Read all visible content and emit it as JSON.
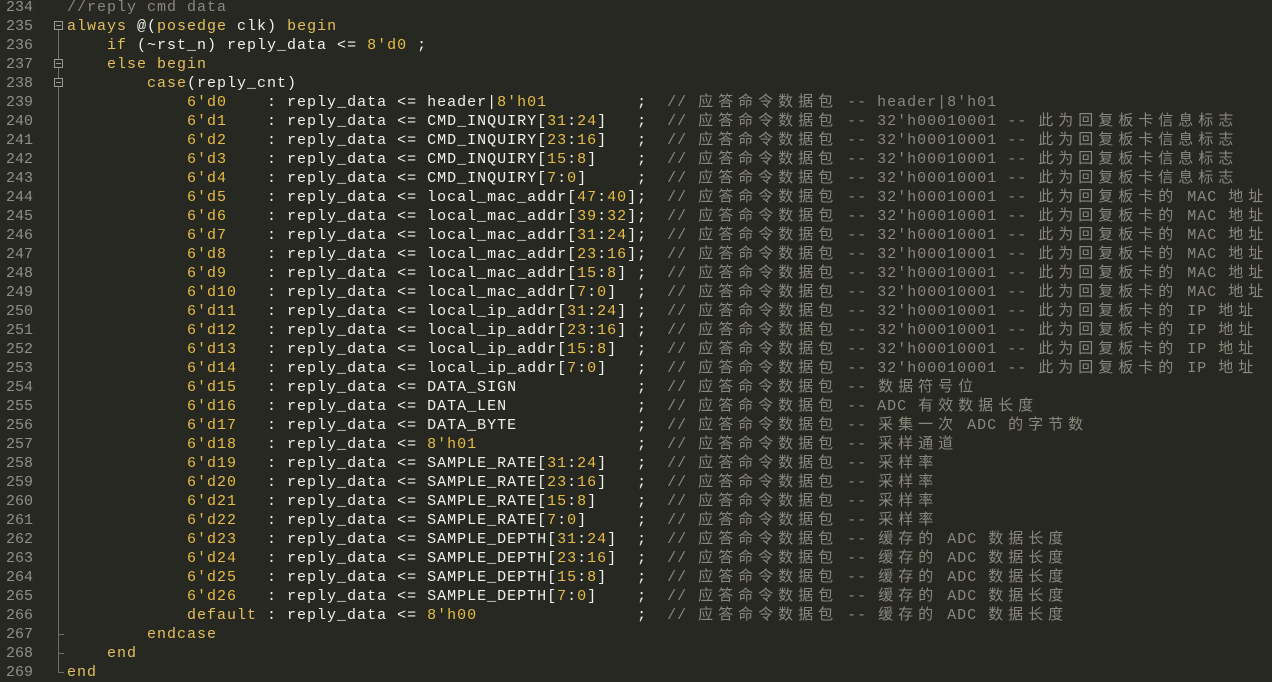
{
  "colors": {
    "background": "#272822",
    "text": "#f1f1ec",
    "keyword": "#e3c05c",
    "number": "#e6bd45",
    "comment": "#8a887d",
    "line_number": "#8f908a"
  },
  "lines": [
    {
      "number": "234",
      "fold": "none",
      "code": "",
      "comment": "//reply cmd data"
    },
    {
      "number": "235",
      "fold": "start",
      "code": "always @(posedge clk) begin",
      "comment": ""
    },
    {
      "number": "236",
      "fold": "body",
      "code": "    if (~rst_n) reply_data <= 8'd0 ;",
      "comment": ""
    },
    {
      "number": "237",
      "fold": "start-nested",
      "code": "    else begin",
      "comment": ""
    },
    {
      "number": "238",
      "fold": "start-nested",
      "code": "        case(reply_cnt)",
      "comment": ""
    },
    {
      "number": "239",
      "fold": "body",
      "code": "            6'd0    : reply_data <= header|8'h01         ;  ",
      "comment": "// 应答命令数据包 -- header|8'h01"
    },
    {
      "number": "240",
      "fold": "body",
      "code": "            6'd1    : reply_data <= CMD_INQUIRY[31:24]   ;  ",
      "comment": "// 应答命令数据包 -- 32'h00010001 -- 此为回复板卡信息标志"
    },
    {
      "number": "241",
      "fold": "body",
      "code": "            6'd2    : reply_data <= CMD_INQUIRY[23:16]   ;  ",
      "comment": "// 应答命令数据包 -- 32'h00010001 -- 此为回复板卡信息标志"
    },
    {
      "number": "242",
      "fold": "body",
      "code": "            6'd3    : reply_data <= CMD_INQUIRY[15:8]    ;  ",
      "comment": "// 应答命令数据包 -- 32'h00010001 -- 此为回复板卡信息标志"
    },
    {
      "number": "243",
      "fold": "body",
      "code": "            6'd4    : reply_data <= CMD_INQUIRY[7:0]     ;  ",
      "comment": "// 应答命令数据包 -- 32'h00010001 -- 此为回复板卡信息标志"
    },
    {
      "number": "244",
      "fold": "body",
      "code": "            6'd5    : reply_data <= local_mac_addr[47:40];  ",
      "comment": "// 应答命令数据包 -- 32'h00010001 -- 此为回复板卡的 MAC 地址"
    },
    {
      "number": "245",
      "fold": "body",
      "code": "            6'd6    : reply_data <= local_mac_addr[39:32];  ",
      "comment": "// 应答命令数据包 -- 32'h00010001 -- 此为回复板卡的 MAC 地址"
    },
    {
      "number": "246",
      "fold": "body",
      "code": "            6'd7    : reply_data <= local_mac_addr[31:24];  ",
      "comment": "// 应答命令数据包 -- 32'h00010001 -- 此为回复板卡的 MAC 地址"
    },
    {
      "number": "247",
      "fold": "body",
      "code": "            6'd8    : reply_data <= local_mac_addr[23:16];  ",
      "comment": "// 应答命令数据包 -- 32'h00010001 -- 此为回复板卡的 MAC 地址"
    },
    {
      "number": "248",
      "fold": "body",
      "code": "            6'd9    : reply_data <= local_mac_addr[15:8] ;  ",
      "comment": "// 应答命令数据包 -- 32'h00010001 -- 此为回复板卡的 MAC 地址"
    },
    {
      "number": "249",
      "fold": "body",
      "code": "            6'd10   : reply_data <= local_mac_addr[7:0]  ;  ",
      "comment": "// 应答命令数据包 -- 32'h00010001 -- 此为回复板卡的 MAC 地址"
    },
    {
      "number": "250",
      "fold": "body",
      "code": "            6'd11   : reply_data <= local_ip_addr[31:24] ;  ",
      "comment": "// 应答命令数据包 -- 32'h00010001 -- 此为回复板卡的 IP 地址"
    },
    {
      "number": "251",
      "fold": "body",
      "code": "            6'd12   : reply_data <= local_ip_addr[23:16] ;  ",
      "comment": "// 应答命令数据包 -- 32'h00010001 -- 此为回复板卡的 IP 地址"
    },
    {
      "number": "252",
      "fold": "body",
      "code": "            6'd13   : reply_data <= local_ip_addr[15:8]  ;  ",
      "comment": "// 应答命令数据包 -- 32'h00010001 -- 此为回复板卡的 IP 地址"
    },
    {
      "number": "253",
      "fold": "body",
      "code": "            6'd14   : reply_data <= local_ip_addr[7:0]   ;  ",
      "comment": "// 应答命令数据包 -- 32'h00010001 -- 此为回复板卡的 IP 地址"
    },
    {
      "number": "254",
      "fold": "body",
      "code": "            6'd15   : reply_data <= DATA_SIGN            ;  ",
      "comment": "// 应答命令数据包 -- 数据符号位"
    },
    {
      "number": "255",
      "fold": "body",
      "code": "            6'd16   : reply_data <= DATA_LEN             ;  ",
      "comment": "// 应答命令数据包 -- ADC 有效数据长度"
    },
    {
      "number": "256",
      "fold": "body",
      "code": "            6'd17   : reply_data <= DATA_BYTE            ;  ",
      "comment": "// 应答命令数据包 -- 采集一次 ADC 的字节数"
    },
    {
      "number": "257",
      "fold": "body",
      "code": "            6'd18   : reply_data <= 8'h01                ;  ",
      "comment": "// 应答命令数据包 -- 采样通道"
    },
    {
      "number": "258",
      "fold": "body",
      "code": "            6'd19   : reply_data <= SAMPLE_RATE[31:24]   ;  ",
      "comment": "// 应答命令数据包 -- 采样率"
    },
    {
      "number": "259",
      "fold": "body",
      "code": "            6'd20   : reply_data <= SAMPLE_RATE[23:16]   ;  ",
      "comment": "// 应答命令数据包 -- 采样率"
    },
    {
      "number": "260",
      "fold": "body",
      "code": "            6'd21   : reply_data <= SAMPLE_RATE[15:8]    ;  ",
      "comment": "// 应答命令数据包 -- 采样率"
    },
    {
      "number": "261",
      "fold": "body",
      "code": "            6'd22   : reply_data <= SAMPLE_RATE[7:0]     ;  ",
      "comment": "// 应答命令数据包 -- 采样率"
    },
    {
      "number": "262",
      "fold": "body",
      "code": "            6'd23   : reply_data <= SAMPLE_DEPTH[31:24]  ;  ",
      "comment": "// 应答命令数据包 -- 缓存的 ADC 数据长度"
    },
    {
      "number": "263",
      "fold": "body",
      "code": "            6'd24   : reply_data <= SAMPLE_DEPTH[23:16]  ;  ",
      "comment": "// 应答命令数据包 -- 缓存的 ADC 数据长度"
    },
    {
      "number": "264",
      "fold": "body",
      "code": "            6'd25   : reply_data <= SAMPLE_DEPTH[15:8]   ;  ",
      "comment": "// 应答命令数据包 -- 缓存的 ADC 数据长度"
    },
    {
      "number": "265",
      "fold": "body",
      "code": "            6'd26   : reply_data <= SAMPLE_DEPTH[7:0]    ;  ",
      "comment": "// 应答命令数据包 -- 缓存的 ADC 数据长度"
    },
    {
      "number": "266",
      "fold": "body",
      "code": "            default : reply_data <= 8'h00                ;  ",
      "comment": "// 应答命令数据包 -- 缓存的 ADC 数据长度"
    },
    {
      "number": "267",
      "fold": "end",
      "code": "        endcase",
      "comment": ""
    },
    {
      "number": "268",
      "fold": "end",
      "code": "    end",
      "comment": ""
    },
    {
      "number": "269",
      "fold": "end-last",
      "code": "end",
      "comment": ""
    }
  ]
}
